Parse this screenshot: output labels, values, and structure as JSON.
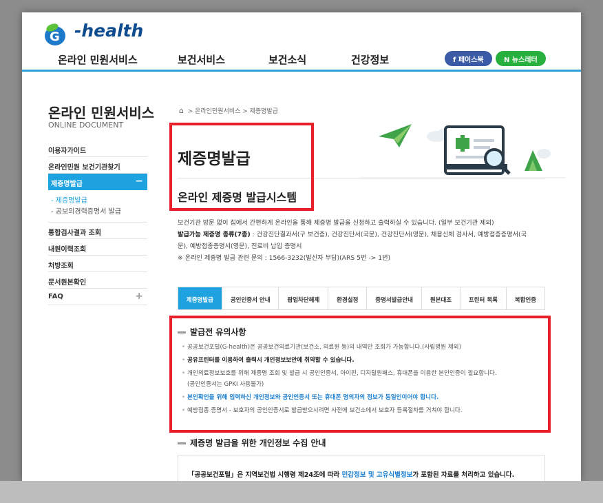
{
  "header": {
    "logo_text": "-health",
    "nav": [
      "온라인 민원서비스",
      "보건서비스",
      "보건소식",
      "건강정보"
    ],
    "facebook_label": "f 페이스북",
    "newsletter_label": "N 뉴스레터"
  },
  "sidebar": {
    "title": "온라인 민원서비스",
    "subtitle": "ONLINE DOCUMENT",
    "items": [
      {
        "label": "이용자가이드"
      },
      {
        "label": "온라인민원 보건기관찾기"
      },
      {
        "label": "제증명발급",
        "active": true,
        "toggle": "−"
      },
      {
        "label": "통합검사결과 조회"
      },
      {
        "label": "내원이력조회"
      },
      {
        "label": "처방조회"
      },
      {
        "label": "문서원본확인"
      },
      {
        "label": "FAQ",
        "toggle": "+"
      }
    ],
    "subitems": [
      "제증명발급",
      "공보의경력증명서 발급"
    ]
  },
  "breadcrumb": "온라인민원서비스 > 제증명발급",
  "page": {
    "title": "제증명발급",
    "subtitle": "온라인 제증명 발급시스템"
  },
  "description": {
    "line1": "보건기관 방문 없이 집에서 간편하게 온라인을 통해 제증명 발급을 신청하고 출력하실 수 있습니다. (일부 보건기관 제외)",
    "line2_bold": "발급가능 제증명 종류(7종)",
    "line2_rest": " : 건강진단결과서(구 보건증), 건강진단서(국문), 건강진단서(영문), 채용신체 검사서, 예방접종증명서(국",
    "line3": "문), 예방접종증명서(영문), 진료비 납입 증명서",
    "line4": "※ 온라인 제증명 발급 관련 문의 : 1566-3232(발신자 부담)(ARS 5번 -> 1번)"
  },
  "tabs": [
    "제증명발급",
    "공인인증서 안내",
    "팝업차단해제",
    "환경설정",
    "증명서발급안내",
    "원본대조",
    "프린터 목록",
    "복합인증"
  ],
  "notice": {
    "heading": "발급전 유의사항",
    "items": [
      "공공보건포털(G-health)은 공공보건의료기관(보건소, 의료원 등)의 내역만 조회가 가능합니다.(사립병원 제외)",
      "공유프린터를 이용하여 출력시 개인정보보안에 취약할 수 있습니다.",
      "개인의료정보보호를 위해 제증명 조회 및 발급 시 공인인증서, 아이핀, 디지털원패스, 휴대폰을 이용한 본인인증이 필요합니다.",
      "(공인인증서는 GPKI 사용불가)",
      "본인확인을 위해 입력하신 개인정보와 공인인증서 또는 휴대폰 명의자의 정보가 동일인이어야 합니다.",
      "예방접종 증명서 - 보호자의 공인인증서로 발급받으시려면 사전에 보건소에서 보호자 등록절차를 거쳐야 합니다."
    ]
  },
  "privacy": {
    "heading": "제증명 발급을 위한 개인정보 수집 안내",
    "text_a": "「공공보건포털」은 지역보건법 시행령 제24조에 따라 ",
    "text_link": "민감정보 및 고유식별정보",
    "text_b": "가 포함된 자료를 처리하고 있습니다."
  },
  "colors": {
    "accent": "#1ea3e0",
    "highlight": "#e8202a",
    "facebook": "#3b5ba6",
    "news": "#28b03e"
  }
}
